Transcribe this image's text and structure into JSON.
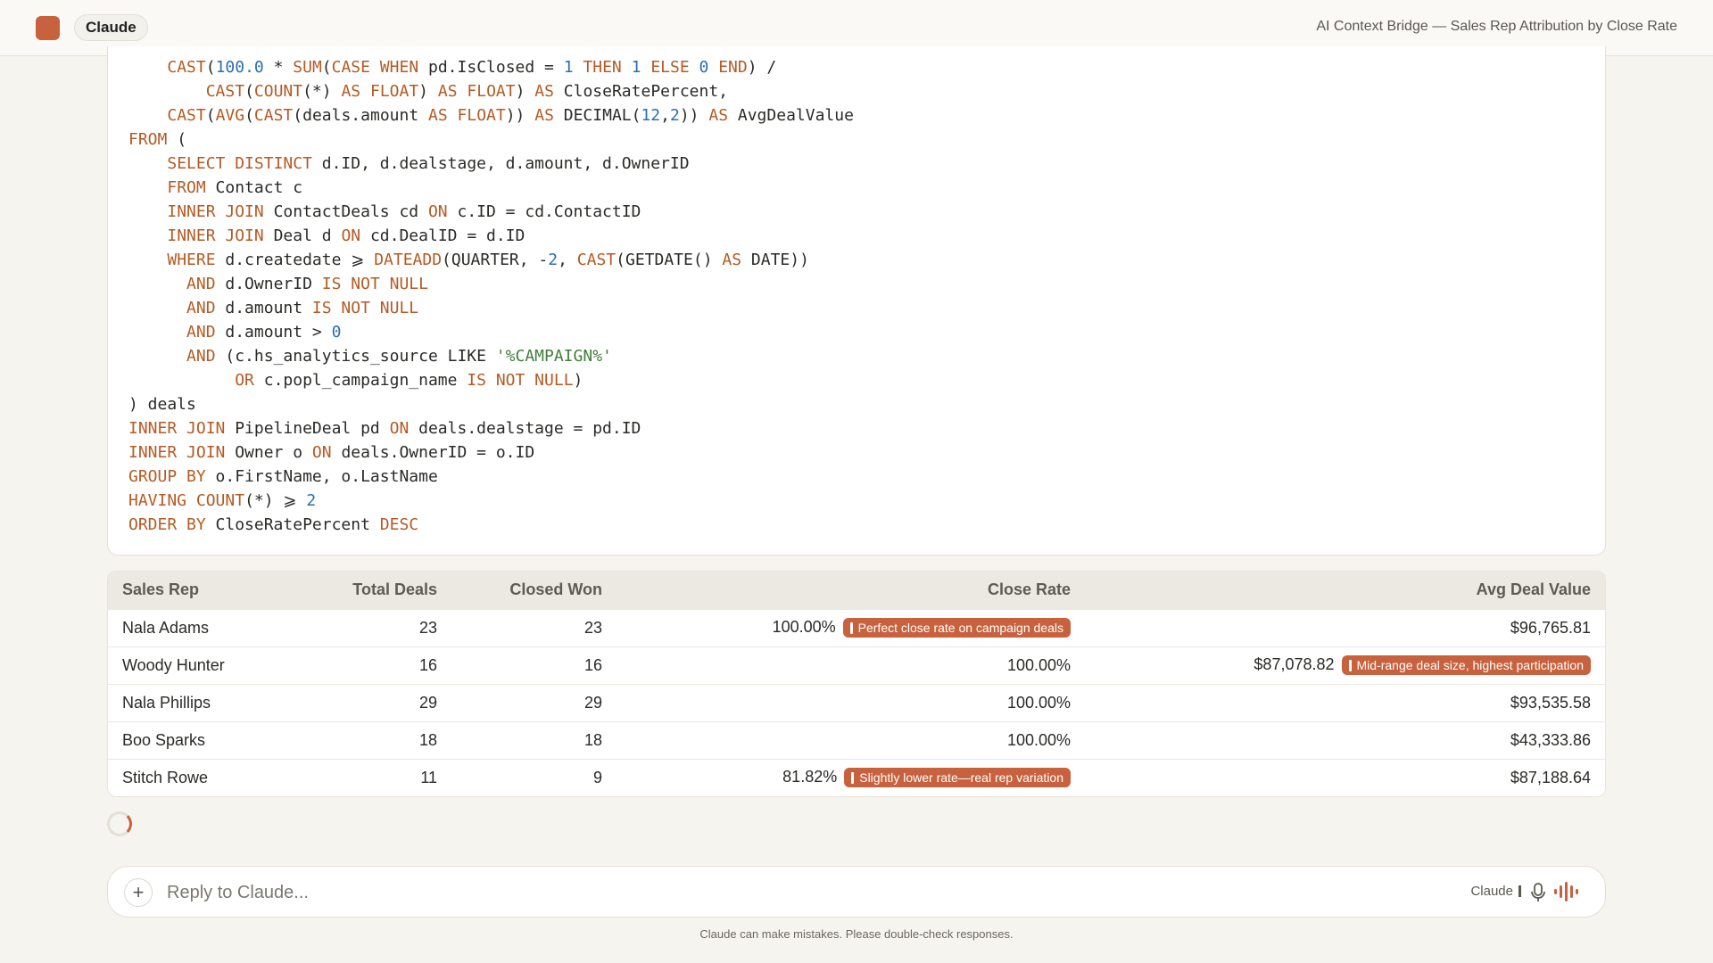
{
  "header": {
    "app_name": "Claude",
    "page_title": "AI Context Bridge — Sales Rep Attribution by Close Rate",
    "accent_color": "#c8613d"
  },
  "code_block": {
    "language": "sql",
    "lines": [
      [
        [
          "",
          "    "
        ],
        [
          "kw",
          "CAST"
        ],
        [
          "",
          "("
        ],
        [
          "num",
          "100.0"
        ],
        [
          "",
          " * "
        ],
        [
          "kw",
          "SUM"
        ],
        [
          "",
          "("
        ],
        [
          "kw",
          "CASE WHEN"
        ],
        [
          "",
          " pd.IsClosed = "
        ],
        [
          "num",
          "1"
        ],
        [
          "",
          " "
        ],
        [
          "kw",
          "THEN"
        ],
        [
          "",
          " "
        ],
        [
          "num",
          "1"
        ],
        [
          "",
          " "
        ],
        [
          "kw",
          "ELSE"
        ],
        [
          "",
          " "
        ],
        [
          "num",
          "0"
        ],
        [
          "",
          " "
        ],
        [
          "kw",
          "END"
        ],
        [
          "",
          ") /"
        ]
      ],
      [
        [
          "",
          "        "
        ],
        [
          "kw",
          "CAST"
        ],
        [
          "",
          "("
        ],
        [
          "kw",
          "COUNT"
        ],
        [
          "",
          "(*) "
        ],
        [
          "kw",
          "AS"
        ],
        [
          "",
          " "
        ],
        [
          "kw",
          "FLOAT"
        ],
        [
          "",
          ") "
        ],
        [
          "kw",
          "AS"
        ],
        [
          "",
          " "
        ],
        [
          "kw",
          "FLOAT"
        ],
        [
          "",
          ") "
        ],
        [
          "kw",
          "AS"
        ],
        [
          "",
          " CloseRatePercent,"
        ]
      ],
      [
        [
          "",
          "    "
        ],
        [
          "kw",
          "CAST"
        ],
        [
          "",
          "("
        ],
        [
          "kw",
          "AVG"
        ],
        [
          "",
          "("
        ],
        [
          "kw",
          "CAST"
        ],
        [
          "",
          "(deals.amount "
        ],
        [
          "kw",
          "AS"
        ],
        [
          "",
          " "
        ],
        [
          "kw",
          "FLOAT"
        ],
        [
          "",
          ")) "
        ],
        [
          "kw",
          "AS"
        ],
        [
          "",
          " DECIMAL("
        ],
        [
          "num",
          "12"
        ],
        [
          "",
          ","
        ],
        [
          "num",
          "2"
        ],
        [
          "",
          ")) "
        ],
        [
          "kw",
          "AS"
        ],
        [
          "",
          " AvgDealValue"
        ]
      ],
      [
        [
          "kw",
          "FROM"
        ],
        [
          "",
          " ("
        ]
      ],
      [
        [
          "",
          "    "
        ],
        [
          "kw",
          "SELECT DISTINCT"
        ],
        [
          "",
          " d.ID, d.dealstage, d.amount, d.OwnerID"
        ]
      ],
      [
        [
          "",
          "    "
        ],
        [
          "kw",
          "FROM"
        ],
        [
          "",
          " Contact c"
        ]
      ],
      [
        [
          "",
          "    "
        ],
        [
          "kw",
          "INNER JOIN"
        ],
        [
          "",
          " ContactDeals cd "
        ],
        [
          "kw",
          "ON"
        ],
        [
          "",
          " c.ID = cd.ContactID"
        ]
      ],
      [
        [
          "",
          "    "
        ],
        [
          "kw",
          "INNER JOIN"
        ],
        [
          "",
          " Deal d "
        ],
        [
          "kw",
          "ON"
        ],
        [
          "",
          " cd.DealID = d.ID"
        ]
      ],
      [
        [
          "",
          "    "
        ],
        [
          "kw",
          "WHERE"
        ],
        [
          "",
          " d.createdate ⩾ "
        ],
        [
          "kw",
          "DATEADD"
        ],
        [
          "",
          "(QUARTER, -"
        ],
        [
          "num",
          "2"
        ],
        [
          "",
          ", "
        ],
        [
          "kw",
          "CAST"
        ],
        [
          "",
          "(GETDATE() "
        ],
        [
          "kw",
          "AS"
        ],
        [
          "",
          " DATE))"
        ]
      ],
      [
        [
          "",
          "      "
        ],
        [
          "kw",
          "AND"
        ],
        [
          "",
          " d.OwnerID "
        ],
        [
          "kw",
          "IS NOT NULL"
        ]
      ],
      [
        [
          "",
          "      "
        ],
        [
          "kw",
          "AND"
        ],
        [
          "",
          " d.amount "
        ],
        [
          "kw",
          "IS NOT NULL"
        ]
      ],
      [
        [
          "",
          "      "
        ],
        [
          "kw",
          "AND"
        ],
        [
          "",
          " d.amount > "
        ],
        [
          "num",
          "0"
        ]
      ],
      [
        [
          "",
          "      "
        ],
        [
          "kw",
          "AND"
        ],
        [
          "",
          " (c.hs_analytics_source LIKE "
        ],
        [
          "str",
          "'%CAMPAIGN%'"
        ]
      ],
      [
        [
          "",
          "           "
        ],
        [
          "kw",
          "OR"
        ],
        [
          "",
          " c.popl_campaign_name "
        ],
        [
          "kw",
          "IS NOT NULL"
        ],
        [
          "",
          ")"
        ]
      ],
      [
        [
          "",
          ") deals"
        ]
      ],
      [
        [
          "kw",
          "INNER JOIN"
        ],
        [
          "",
          " PipelineDeal pd "
        ],
        [
          "kw",
          "ON"
        ],
        [
          "",
          " deals.dealstage = pd.ID"
        ]
      ],
      [
        [
          "kw",
          "INNER JOIN"
        ],
        [
          "",
          " Owner o "
        ],
        [
          "kw",
          "ON"
        ],
        [
          "",
          " deals.OwnerID = o.ID"
        ]
      ],
      [
        [
          "kw",
          "GROUP BY"
        ],
        [
          "",
          " o.FirstName, o.LastName"
        ]
      ],
      [
        [
          "kw",
          "HAVING"
        ],
        [
          "",
          " "
        ],
        [
          "kw",
          "COUNT"
        ],
        [
          "",
          "(*) ⩾ "
        ],
        [
          "num",
          "2"
        ]
      ],
      [
        [
          "kw",
          "ORDER BY"
        ],
        [
          "",
          " CloseRatePercent "
        ],
        [
          "kw",
          "DESC"
        ]
      ]
    ]
  },
  "results_table": {
    "headers": {
      "sales_rep": "Sales Rep",
      "total_deals": "Total Deals",
      "closed_won": "Closed Won",
      "close_rate": "Close Rate",
      "avg_deal_value": "Avg Deal Value"
    },
    "rows": [
      {
        "rep": "Nala Adams",
        "total": "23",
        "closed": "23",
        "rate": "100.00%",
        "rate_badge": "Perfect close rate on campaign deals",
        "avg": "$96,765.81",
        "avg_badge": ""
      },
      {
        "rep": "Woody Hunter",
        "total": "16",
        "closed": "16",
        "rate": "100.00%",
        "rate_badge": "",
        "avg": "$87,078.82",
        "avg_badge": "Mid-range deal size, highest participation"
      },
      {
        "rep": "Nala Phillips",
        "total": "29",
        "closed": "29",
        "rate": "100.00%",
        "rate_badge": "",
        "avg": "$93,535.58",
        "avg_badge": ""
      },
      {
        "rep": "Boo Sparks",
        "total": "18",
        "closed": "18",
        "rate": "100.00%",
        "rate_badge": "",
        "avg": "$43,333.86",
        "avg_badge": ""
      },
      {
        "rep": "Stitch Rowe",
        "total": "11",
        "closed": "9",
        "rate": "81.82%",
        "rate_badge": "Slightly lower rate—real rep variation",
        "avg": "$87,188.64",
        "avg_badge": ""
      }
    ]
  },
  "composer": {
    "placeholder": "Reply to Claude...",
    "value": "",
    "model_label": "Claude",
    "plus_icon": "plus-icon",
    "mic_icon": "microphone-icon",
    "voice_icon": "voice-waveform-icon"
  },
  "footer": {
    "disclaimer": "Claude can make mistakes. Please double-check responses."
  }
}
